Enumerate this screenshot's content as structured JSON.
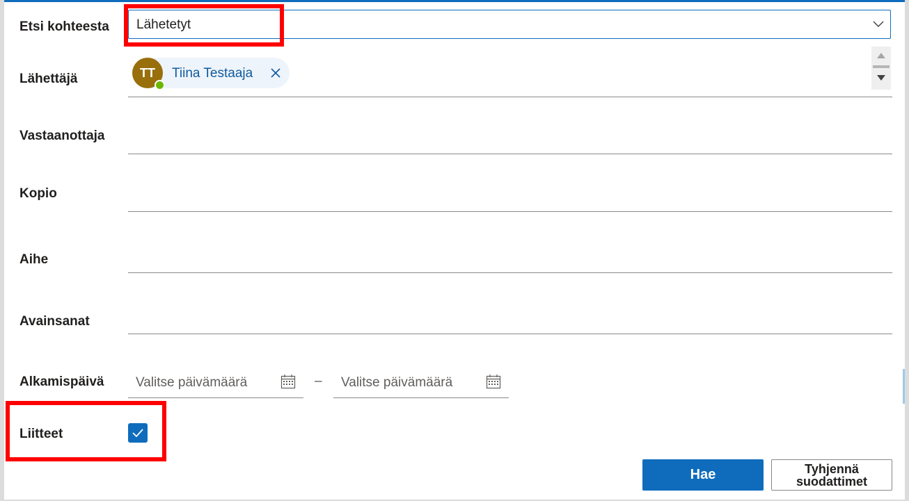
{
  "form": {
    "search_in": {
      "label": "Etsi kohteesta",
      "selected": "Lähetetyt",
      "icon": "chevron-down-icon"
    },
    "from": {
      "label": "Lähettäjä",
      "person": {
        "initials": "TT",
        "name": "Tiina Testaaja",
        "avatar_color": "#986f0b",
        "presence_color": "#6bb700"
      }
    },
    "to": {
      "label": "Vastaanottaja"
    },
    "cc": {
      "label": "Kopio"
    },
    "subject": {
      "label": "Aihe"
    },
    "keywords": {
      "label": "Avainsanat"
    },
    "start_date": {
      "label": "Alkamispäivä",
      "from_placeholder": "Valitse päivämäärä",
      "to_placeholder": "Valitse päivämäärä",
      "separator": "–",
      "icon": "calendar-icon"
    },
    "attachments": {
      "label": "Liitteet",
      "checked": true
    }
  },
  "actions": {
    "search_label": "Hae",
    "clear_line1": "Tyhjennä",
    "clear_line2": "suodattimet"
  },
  "colors": {
    "accent": "#0f6cbd",
    "highlight": "#ff0000",
    "chip_text": "#0f5a9e",
    "chip_bg": "#eef4fb"
  }
}
